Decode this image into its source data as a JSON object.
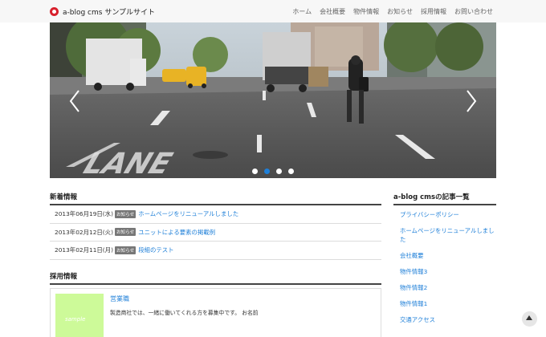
{
  "header": {
    "brand": "a-blog cms サンプルサイト",
    "logo_icon": "a-blog-logo-icon",
    "nav": [
      "ホーム",
      "会社概要",
      "物件情報",
      "お知らせ",
      "採用情報",
      "お問い合わせ"
    ]
  },
  "slider": {
    "image": "city-street-lane-photo",
    "road_text": "LANE",
    "prev_icon": "chevron-left-icon",
    "next_icon": "chevron-right-icon",
    "dots_count": 4,
    "active_dot": 2
  },
  "news": {
    "title": "新着情報",
    "items": [
      {
        "date": "2013年06月19日(水)",
        "badge": "お知らせ",
        "text": "ホームページをリニューアルしました"
      },
      {
        "date": "2013年02月12日(火)",
        "badge": "お知らせ",
        "text": "ユニットによる要素の掲載例"
      },
      {
        "date": "2013年02月11日(月)",
        "badge": "お知らせ",
        "text": "段組のテスト"
      }
    ]
  },
  "jobs": {
    "title": "採用情報",
    "item": {
      "title": "営業職",
      "description": "製造商社では、一緒に働いてくれる方を募集中です。 お名前",
      "thumb_label": "sample"
    }
  },
  "sidebar": {
    "title": "a-blog cmsの記事一覧",
    "items": [
      "プライバシーポリシー",
      "ホームページをリニューアルしました",
      "会社概要",
      "物件情報3",
      "物件情報2",
      "物件情報1",
      "交通アクセス"
    ]
  },
  "scroll_top_icon": "arrow-up-icon",
  "colors": {
    "accent": "#1e7fd8",
    "logo": "#d8202c",
    "badge": "#777777",
    "thumb": "#cdfa99"
  }
}
